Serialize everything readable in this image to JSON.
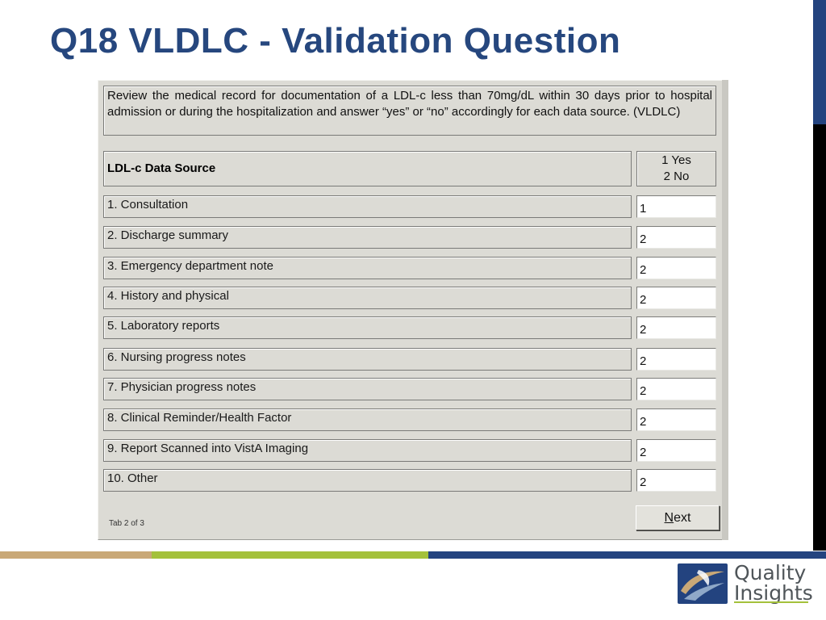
{
  "slide": {
    "title": "Q18 VLDLC - Validation Question"
  },
  "form": {
    "instruction": "Review the medical record for documentation of a LDL-c less than 70mg/dL within 30 days prior to hospital admission or during the hospitalization and answer “yes” or “no” accordingly for each data source. (VLDLC)",
    "header_label": "LDL-c Data Source",
    "answer_header_line1": "1 Yes",
    "answer_header_line2": "2 No",
    "rows": [
      {
        "label": "1.  Consultation",
        "value": "1"
      },
      {
        "label": "2.  Discharge summary",
        "value": "2"
      },
      {
        "label": "3.  Emergency department note",
        "value": "2"
      },
      {
        "label": "4.  History and physical",
        "value": "2"
      },
      {
        "label": "5.  Laboratory reports",
        "value": "2"
      },
      {
        "label": "6.  Nursing progress notes",
        "value": "2"
      },
      {
        "label": "7.  Physician progress notes",
        "value": "2"
      },
      {
        "label": "8. Clinical Reminder/Health Factor",
        "value": "2"
      },
      {
        "label": "9. Report Scanned into VistA Imaging",
        "value": "2"
      },
      {
        "label": "10. Other",
        "value": "2"
      }
    ],
    "tab_indicator": "Tab 2 of 3",
    "next_button": {
      "mnemonic": "N",
      "rest": "ext"
    }
  },
  "footer": {
    "logo_line1": "Quality",
    "logo_line2": "Insights",
    "stripe_colors": [
      "#c9a877",
      "#a4c13b",
      "#23437f"
    ]
  },
  "colors": {
    "title": "#26477e",
    "panel": "#dcdbd5",
    "accent_blue": "#23437f"
  }
}
